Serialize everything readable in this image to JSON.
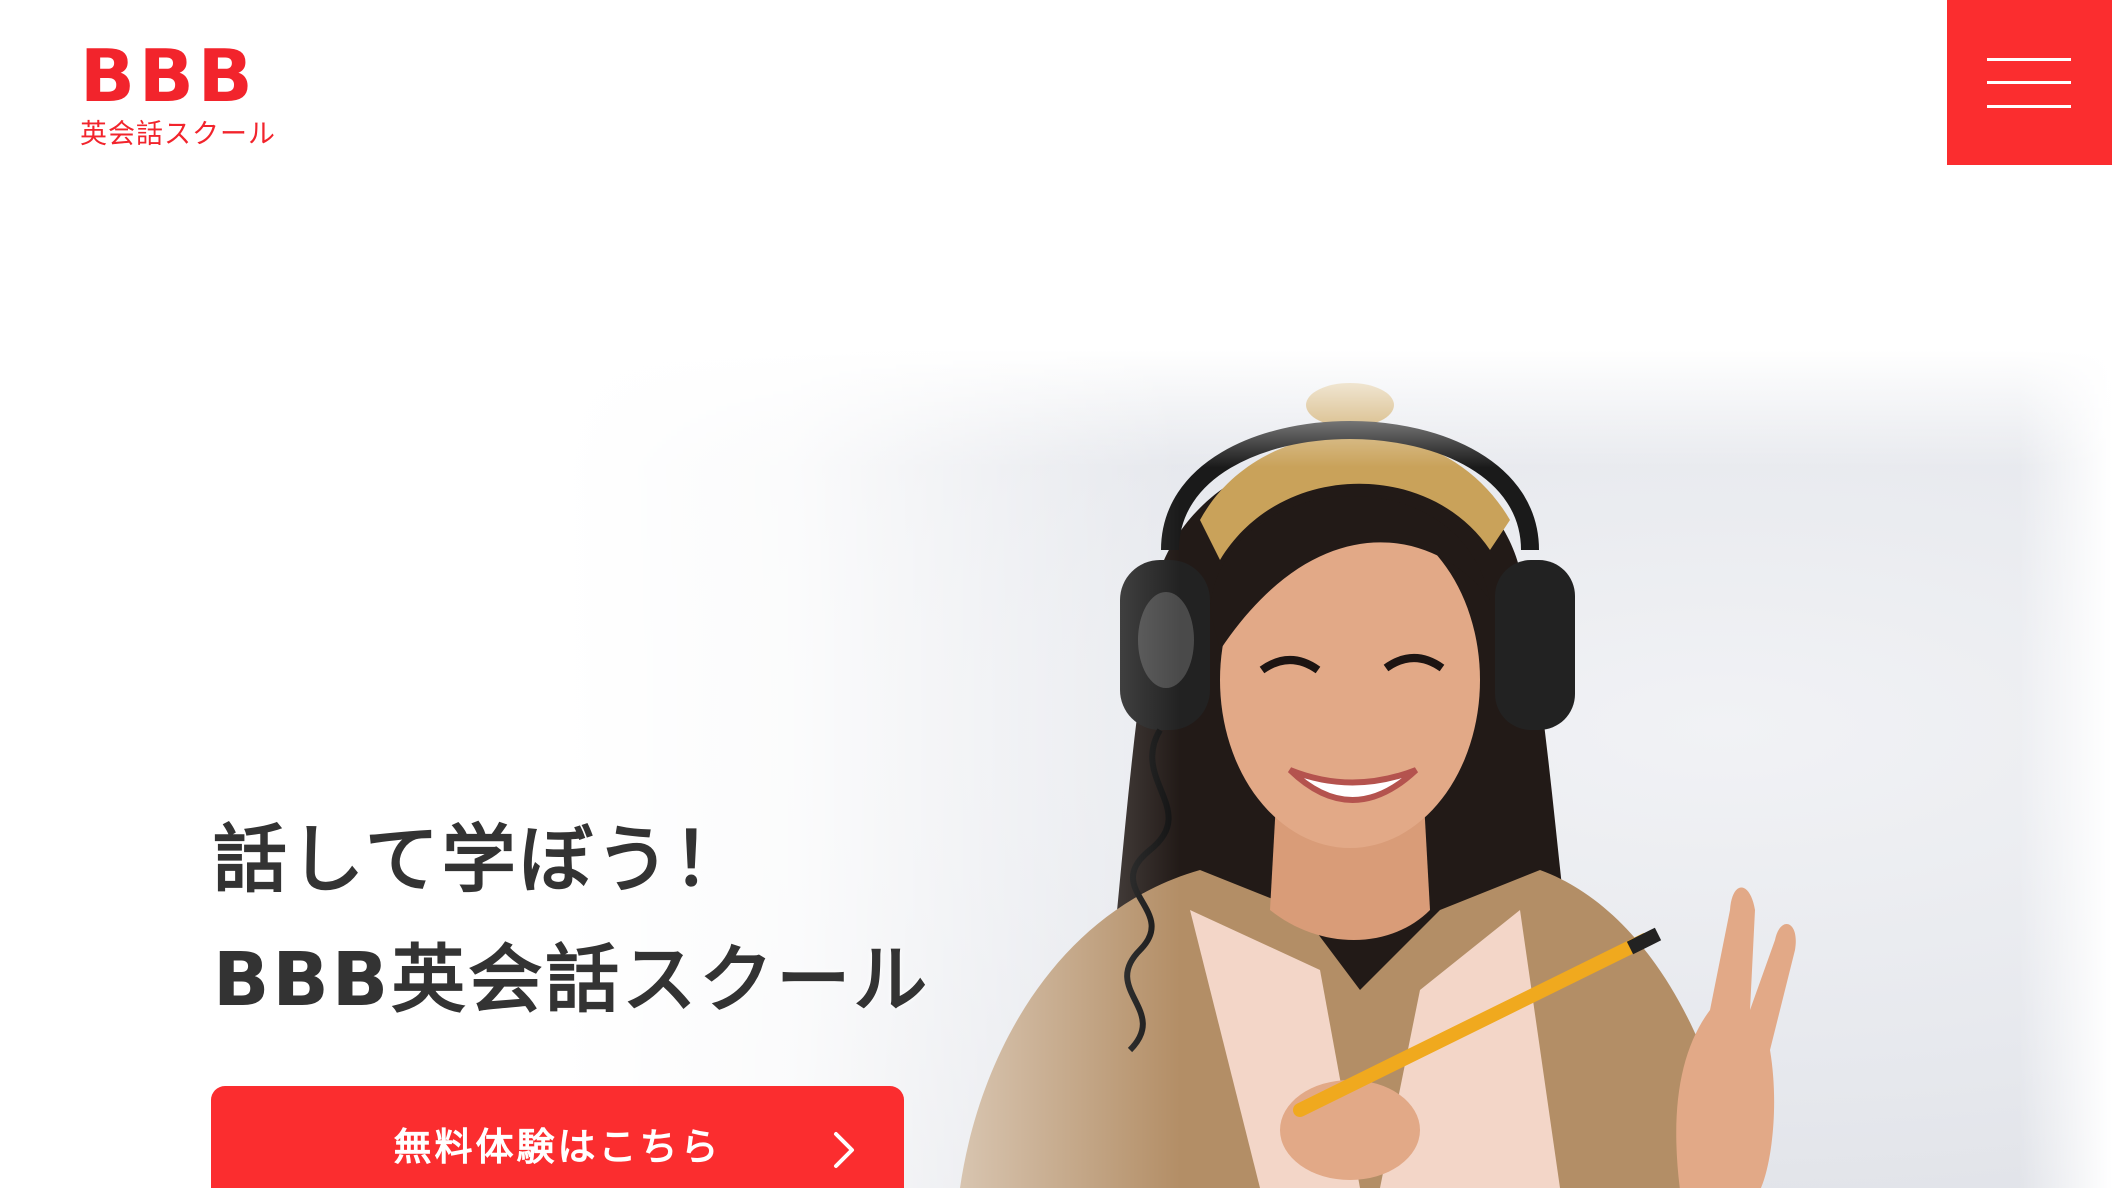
{
  "brand": {
    "mark": "BBB",
    "sub": "英会話スクール",
    "color": "#f2242c"
  },
  "header": {
    "menu_icon": "hamburger-menu-icon",
    "menu_color": "#fb2d2f"
  },
  "hero": {
    "line1": "話して学ぼう！",
    "line2": "BBB英会話スクール",
    "cta_label": "無料体験はこちら",
    "cta_icon": "chevron-right-icon",
    "cta_color": "#fb2d2f"
  }
}
